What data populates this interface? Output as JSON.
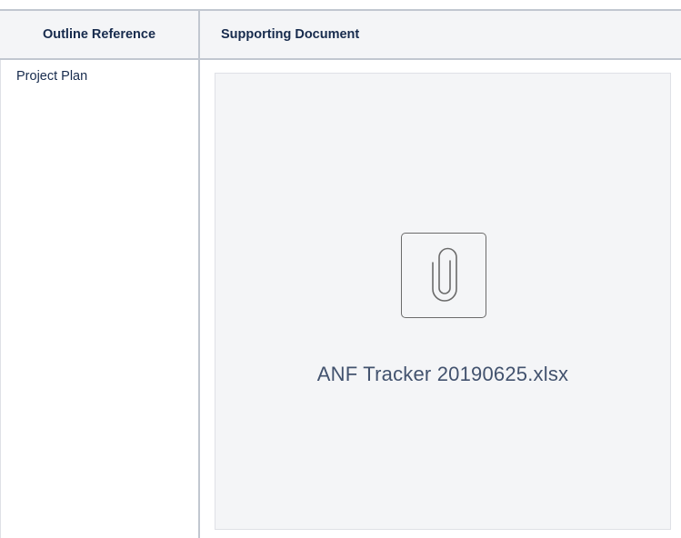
{
  "table": {
    "headers": [
      "Outline Reference",
      "Supporting Document"
    ],
    "rows": [
      {
        "outline_reference": "Project Plan",
        "attachment": {
          "icon": "paperclip-icon",
          "file_name": "ANF Tracker 20190625.xlsx"
        }
      }
    ]
  }
}
